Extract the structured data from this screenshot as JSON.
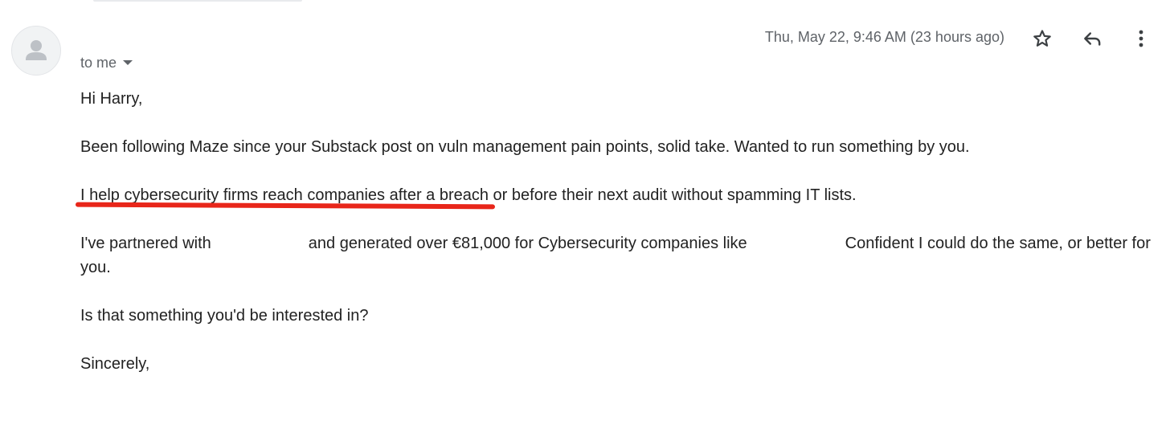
{
  "message": {
    "recipient_label": "to me",
    "timestamp": "Thu, May 22, 9:46 AM (23 hours ago)",
    "greeting": "Hi Harry,",
    "para1": "Been following Maze since your Substack post on vuln management pain points, solid take. Wanted to run something by you.",
    "para2": "I help cybersecurity firms reach companies after a breach or before their next audit without spamming IT lists.",
    "para3_part1": "I've partnered with",
    "para3_part2": "and generated over €81,000 for Cybersecurity companies like",
    "para3_part3": "Confident I could do the same, or better for you.",
    "para4": "Is that something you'd be interested in?",
    "closing": "Sincerely,"
  },
  "icons": {
    "avatar": "person-avatar-icon",
    "recipient_caret": "caret-down-icon",
    "star": "star-icon",
    "reply": "reply-icon",
    "more": "more-vert-icon"
  },
  "colors": {
    "annotation_underline": "#e8261a",
    "meta_text": "#5f6368",
    "body_text": "#222222"
  }
}
